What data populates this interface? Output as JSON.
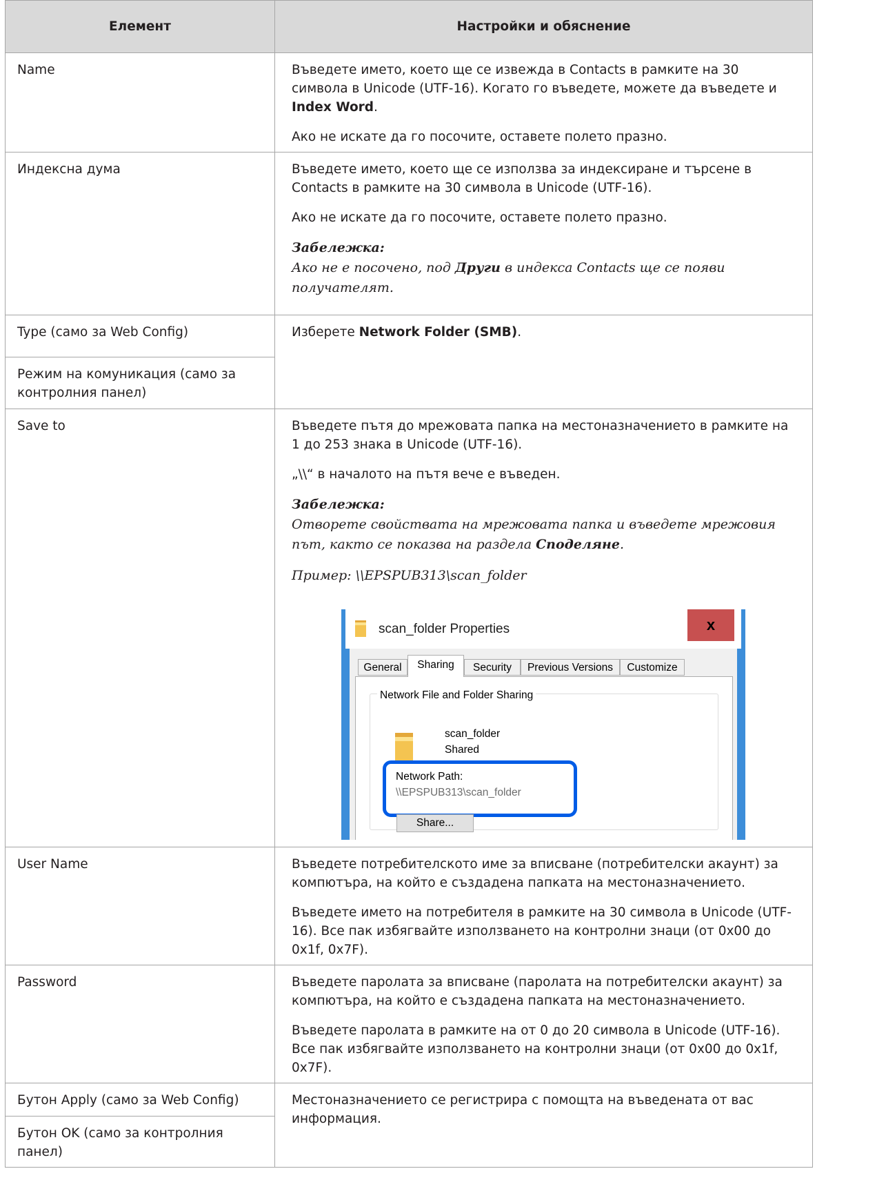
{
  "table": {
    "headers": {
      "item": "Елемент",
      "settings": "Настройки и обяснение"
    },
    "rows": {
      "name": {
        "label": "Name",
        "p1_a": "Въведете името, което ще се извежда в Contacts в рамките на 30 символа в Unicode (UTF-16). Когато го въведете, можете да въведете и ",
        "p1_bold": "Index Word",
        "p1_b": ".",
        "p2": "Ако не искате да го посочите, оставете полето празно."
      },
      "index": {
        "label": "Индексна дума",
        "p1": "Въведете името, което ще се използва за индексиране и търсене в Contacts в рамките на 30 символа в Unicode (UTF-16).",
        "p2": "Ако не искате да го посочите, оставете полето празно.",
        "note_title": "Забележка:",
        "note_a": "Ако не е посочено, под ",
        "note_bold": "Други",
        "note_b": " в индекса Contacts ще се появи получателят."
      },
      "type": {
        "label1": "Type (само за Web Config)",
        "label2": "Режим на комуникация (само за контролния панел)",
        "p1_a": "Изберете ",
        "p1_bold": "Network Folder (SMB)",
        "p1_b": "."
      },
      "save_to": {
        "label": "Save to",
        "p1": "Въведете пътя до мрежовата папка на местоназначението в рамките на 1 до 253 знака в Unicode (UTF-16).",
        "p2": "„\\\\“ в началото на пътя вече е въведен.",
        "note_title": "Забележка:",
        "note_a": "Отворете свойствата на мрежовата папка и въведете мрежовия път, както се показва на раздела ",
        "note_bold": "Споделяне",
        "note_b": ".",
        "example": "Пример: \\\\EPSPUB313\\scan_folder"
      },
      "user_name": {
        "label": "User Name",
        "p1": "Въведете потребителското име за вписване (потребителски акаунт) за компютъра, на който е създадена папката на местоназначението.",
        "p2": "Въведете името на потребителя в рамките на 30 символа в Unicode (UTF-16). Все пак избягвайте използването на контролни знаци (от 0x00 до 0x1f, 0x7F)."
      },
      "password": {
        "label": "Password",
        "p1": "Въведете паролата за вписване (паролата на потребителски акаунт) за компютъра, на който е създадена папката на местоназначението.",
        "p2": "Въведете паролата в рамките на от 0 до 20 символа в Unicode (UTF-16). Все пак избягвайте използването на контролни знаци (от 0x00 до 0x1f, 0x7F)."
      },
      "apply": {
        "label1": "Бутон Apply (само за Web Config)",
        "label2": "Бутон OK (само за контролния панел)",
        "p1": "Местоназначението се регистрира с помощта на въведената от вас информация."
      }
    }
  },
  "dialog": {
    "title": "scan_folder Properties",
    "close_symbol": "x",
    "tabs": [
      "General",
      "Sharing",
      "Security",
      "Previous Versions",
      "Customize"
    ],
    "active_tab": "Sharing",
    "group_label": "Network File and Folder Sharing",
    "folder_name": "scan_folder",
    "folder_state": "Shared",
    "network_path_label": "Network Path:",
    "network_path_value": "\\\\EPSPUB313\\scan_folder",
    "share_button": "Share...",
    "icons": {
      "title": "folder-icon",
      "shared_folder": "folder-icon",
      "close": "close-icon"
    },
    "colors": {
      "frame": "#3c8dd9",
      "close_button": "#c75050",
      "highlight": "#005ce6",
      "folder": "#f4c451"
    }
  }
}
